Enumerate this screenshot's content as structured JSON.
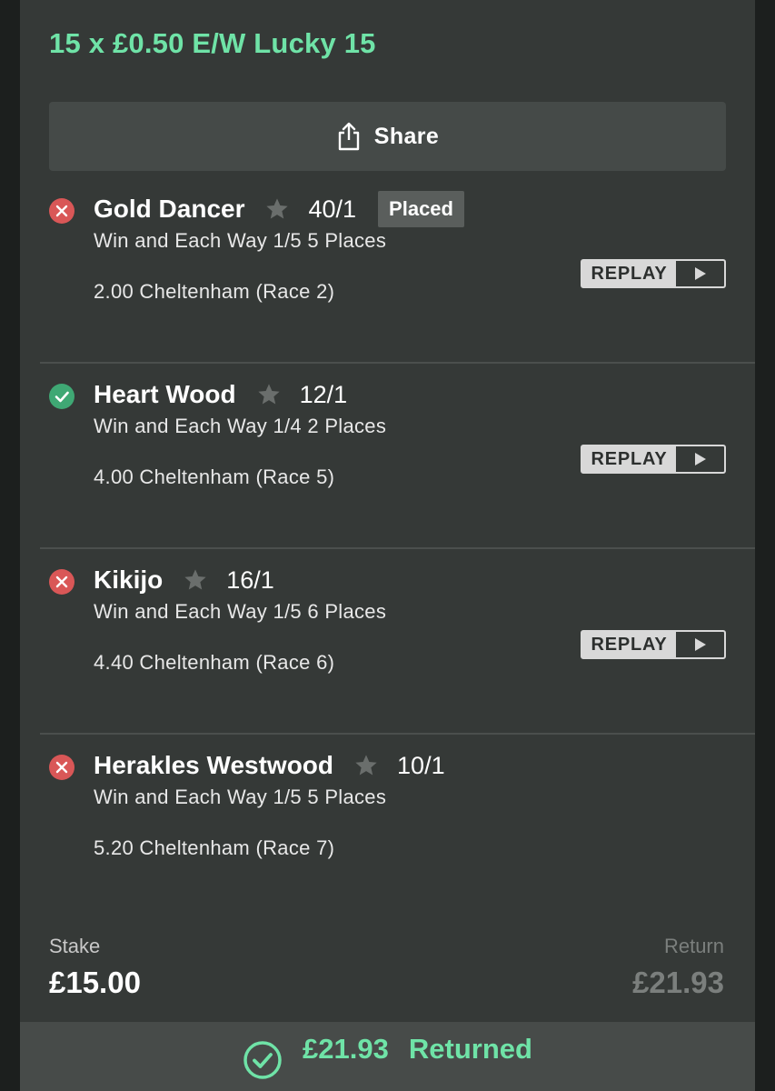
{
  "bet": {
    "title": "15 x £0.50 E/W Lucky 15"
  },
  "share": {
    "label": "Share"
  },
  "selections": [
    {
      "status": "lost",
      "horse": "Gold Dancer",
      "odds": "40/1",
      "badge": "Placed",
      "market": "Win and Each Way 1/5 5 Places",
      "race": "2.00 Cheltenham (Race 2)",
      "replay": "REPLAY"
    },
    {
      "status": "won",
      "horse": "Heart Wood",
      "odds": "12/1",
      "badge": "",
      "market": "Win and Each Way 1/4 2 Places",
      "race": "4.00 Cheltenham (Race 5)",
      "replay": "REPLAY"
    },
    {
      "status": "lost",
      "horse": "Kikijo",
      "odds": "16/1",
      "badge": "",
      "market": "Win and Each Way 1/5 6 Places",
      "race": "4.40 Cheltenham (Race 6)",
      "replay": "REPLAY"
    },
    {
      "status": "lost",
      "horse": "Herakles Westwood",
      "odds": "10/1",
      "badge": "",
      "market": "Win and Each Way 1/5 5 Places",
      "race": "5.20 Cheltenham (Race 7)",
      "replay": ""
    }
  ],
  "summary": {
    "stake_label": "Stake",
    "stake_value": "£15.00",
    "return_label": "Return",
    "return_value": "£21.93"
  },
  "result": {
    "amount": "£21.93",
    "label": "Returned"
  },
  "colors": {
    "accent_green": "#6fe3a7",
    "lost_red": "#d95757",
    "won_green": "#3fa874",
    "card_bg": "#353937"
  },
  "icons": {
    "share": "share-icon",
    "lost": "cross-circle-icon",
    "won": "check-circle-icon",
    "favourite": "star-icon",
    "play": "play-icon",
    "returned": "check-circle-outline-icon"
  }
}
